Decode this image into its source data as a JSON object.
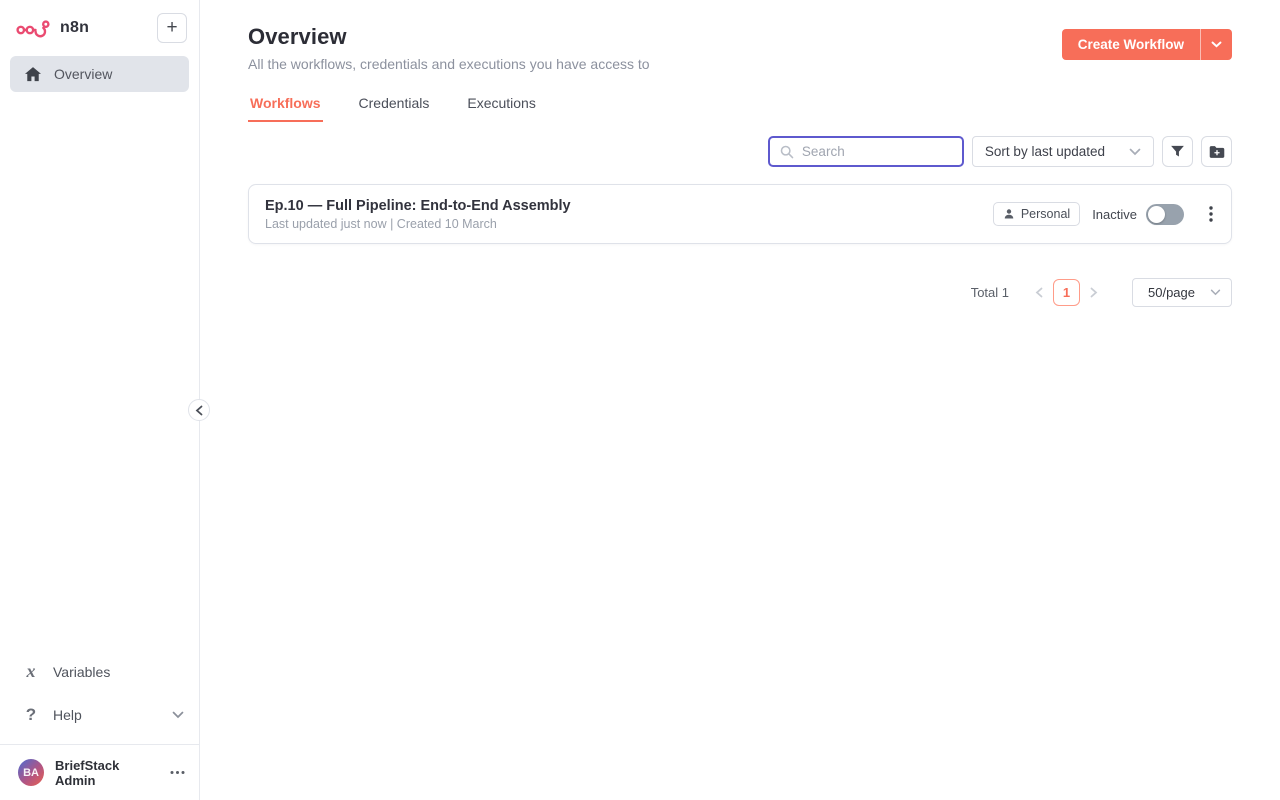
{
  "brand": {
    "name": "n8n"
  },
  "icons": {
    "plus": "+",
    "question": "?",
    "variables": "x"
  },
  "sidebar": {
    "items": [
      {
        "label": "Overview",
        "icon": "home",
        "active": true
      }
    ],
    "footer": {
      "variables_label": "Variables",
      "help_label": "Help",
      "user": {
        "initials": "BA",
        "name": "BriefStack Admin"
      }
    }
  },
  "header": {
    "title": "Overview",
    "subtitle": "All the workflows, credentials and executions you have access to",
    "create_button_label": "Create Workflow"
  },
  "tabs": [
    {
      "label": "Workflows",
      "active": true
    },
    {
      "label": "Credentials",
      "active": false
    },
    {
      "label": "Executions",
      "active": false
    }
  ],
  "controls": {
    "search_placeholder": "Search",
    "sort_label": "Sort by last updated"
  },
  "workflows": [
    {
      "title": "Ep.10 — Full Pipeline: End-to-End Assembly",
      "meta": "Last updated just now | Created 10 March",
      "owner_badge": "Personal",
      "status_label": "Inactive",
      "active": false
    }
  ],
  "pagination": {
    "total_label": "Total 1",
    "page": "1",
    "page_size": "50/page"
  },
  "colors": {
    "primary": "#f76e59",
    "logo_pink": "#ea4b71",
    "search_focus_border": "#5e59ce",
    "active_nav_bg": "#e1e4ea",
    "toggle_off": "#98a2ad"
  }
}
